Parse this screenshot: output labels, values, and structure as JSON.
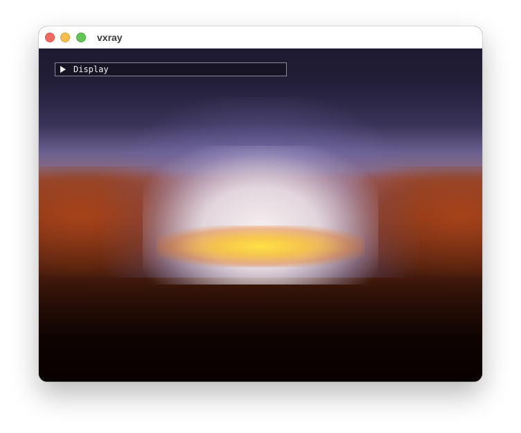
{
  "window": {
    "title": "vxray"
  },
  "overlay": {
    "display_panel": {
      "label": "Display",
      "expanded": false,
      "toggle_icon": "triangle-right-icon"
    }
  },
  "scene": {
    "sky_colors": {
      "zenith": "#1d1a30",
      "horizon_glow": "#f0eaea",
      "sun": "#ffd93a",
      "ground_near": "#8c3a1c",
      "ground_far": "#080101"
    }
  }
}
